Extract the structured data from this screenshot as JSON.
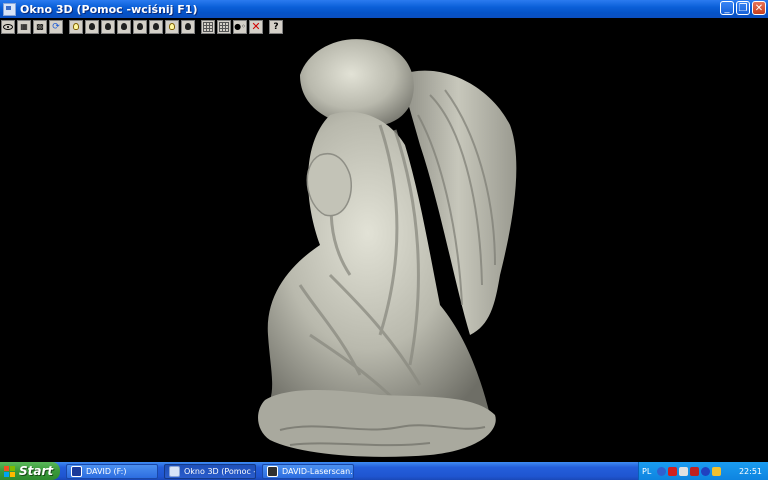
{
  "window": {
    "title": "Okno 3D (Pomoc -wciśnij F1)",
    "controls": [
      "minimize-icon",
      "restore-icon",
      "close-icon"
    ]
  },
  "toolbar": {
    "buttons": [
      {
        "name": "view-eye-icon"
      },
      {
        "name": "render-mode-icon"
      },
      {
        "name": "texture-mode-icon"
      },
      {
        "name": "rotate-mode-icon"
      },
      {
        "name": "light-1-icon"
      },
      {
        "name": "light-2-icon"
      },
      {
        "name": "light-3-icon"
      },
      {
        "name": "light-4-icon"
      },
      {
        "name": "light-5-icon"
      },
      {
        "name": "light-6-icon"
      },
      {
        "name": "light-7-icon"
      },
      {
        "name": "light-8-icon"
      },
      {
        "name": "grid-1-icon"
      },
      {
        "name": "grid-2-icon"
      },
      {
        "name": "points-icon"
      },
      {
        "name": "delete-icon"
      },
      {
        "name": "help-icon"
      }
    ],
    "help_label": "?"
  },
  "viewport": {
    "background": "#000000",
    "model_color": "#c9c9bd",
    "model_description_icon": "3d-angel-statue-model"
  },
  "taskbar": {
    "start_label": "Start",
    "tasks": [
      {
        "label": "DAVID (F:)"
      },
      {
        "label": "Okno 3D (Pomoc -..."
      },
      {
        "label": "DAVID-Laserscan..."
      }
    ],
    "language": "PL",
    "clock": "22:51"
  },
  "colors": {
    "titlebar_blue": "#0a5fd8",
    "taskbar_blue": "#245edb",
    "start_green": "#3a9a3a",
    "tray_blue": "#0e84e0"
  }
}
